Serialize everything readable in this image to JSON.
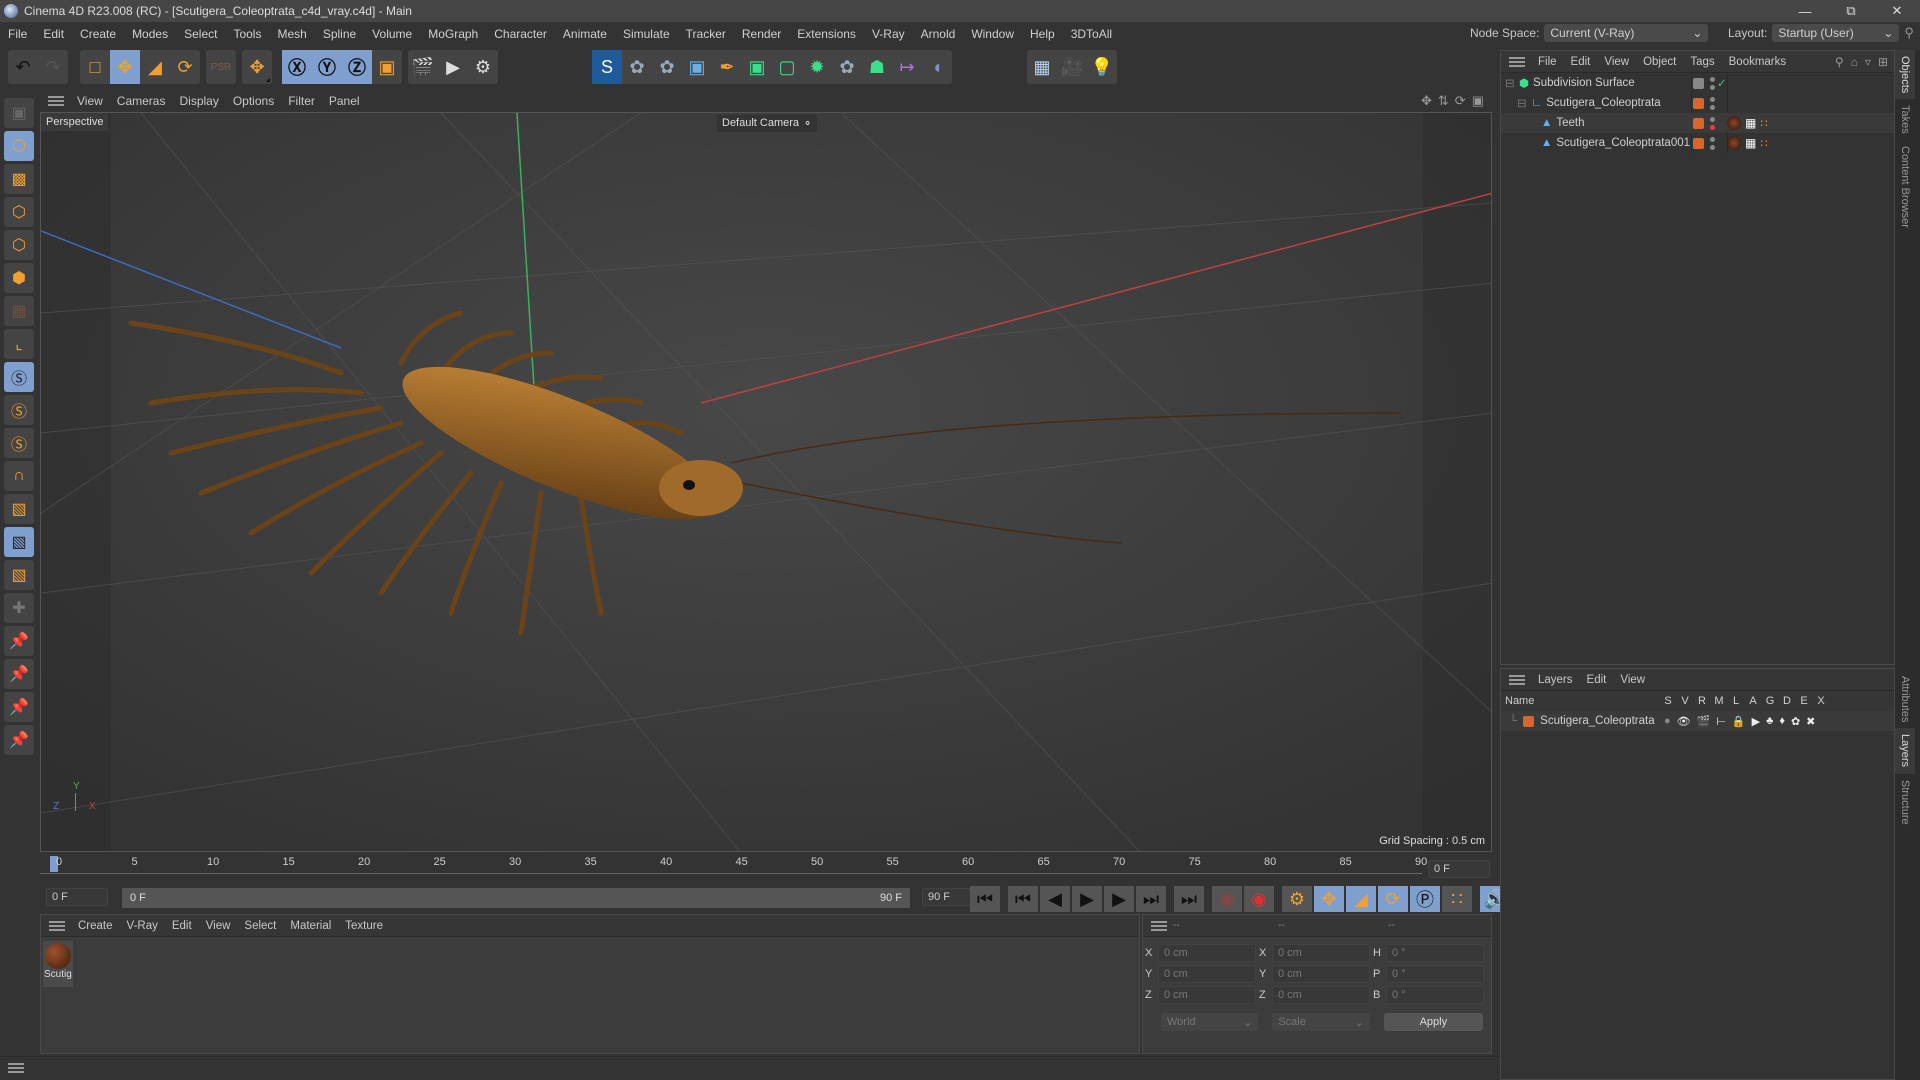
{
  "app": {
    "title": "Cinema 4D R23.008 (RC) - [Scutigera_Coleoptrata_c4d_vray.c4d] - Main",
    "window_controls": [
      "minimize",
      "restore",
      "close"
    ]
  },
  "menubar": [
    "File",
    "Edit",
    "Create",
    "Modes",
    "Select",
    "Tools",
    "Mesh",
    "Spline",
    "Volume",
    "MoGraph",
    "Character",
    "Animate",
    "Simulate",
    "Tracker",
    "Render",
    "Extensions",
    "V-Ray",
    "Arnold",
    "Window",
    "Help",
    "3DToAll"
  ],
  "node_space": {
    "label": "Node Space:",
    "value": "Current (V-Ray)"
  },
  "layout": {
    "label": "Layout:",
    "value": "Startup (User)"
  },
  "toolbar": {
    "groups": [
      [
        "undo-icon",
        "redo-icon"
      ],
      [
        "live-selection-icon",
        "move-icon",
        "scale-icon",
        "rotate-icon"
      ],
      [
        "psr-icon"
      ],
      [
        "transform-icon"
      ],
      [
        "x-axis-icon",
        "y-axis-icon",
        "z-axis-icon",
        "coordinate-system-icon"
      ],
      [
        "render-view-icon",
        "render-picture-viewer-icon",
        "render-settings-icon"
      ],
      [
        "vray-icon",
        "python-icon",
        "python-icon",
        "cube-icon",
        "pen-icon",
        "subdivision-icon",
        "extrude-icon",
        "mesh-icon",
        "python-icon",
        "cloner-icon",
        "bend-icon",
        "deformer-icon"
      ],
      [
        "floor-icon",
        "camera-icon",
        "light-icon"
      ]
    ],
    "active": [
      "move-icon",
      "x-axis-icon",
      "y-axis-icon",
      "z-axis-icon",
      "vray-icon"
    ]
  },
  "left_tools": [
    "make-editable-icon",
    "model-mode-icon",
    "texture-mode-icon",
    "point-mode-icon",
    "edge-mode-icon",
    "polygon-mode-icon",
    "uv-mode-icon",
    "axis-icon",
    "snap-icon",
    "snap-settings-icon",
    "snap-special-icon",
    "magnet-icon",
    "workplane-icon",
    "workplane-lock-icon",
    "workplane-align-icon",
    "add-joint-icon",
    "pin-icon",
    "pin-p-icon",
    "pin-r-icon",
    "pin-scale-icon"
  ],
  "viewport": {
    "menu": [
      "View",
      "Cameras",
      "Display",
      "Options",
      "Filter",
      "Panel"
    ],
    "label": "Perspective",
    "camera": "Default Camera",
    "grid_spacing": "Grid Spacing : 0.5 cm",
    "axis_labels": {
      "x": "X",
      "y": "Y",
      "z": "Z"
    },
    "nav_icons": [
      "move-view-icon",
      "dolly-view-icon",
      "rotate-view-icon",
      "toggle-view-icon"
    ]
  },
  "timeline": {
    "ticks": [
      "0",
      "5",
      "10",
      "15",
      "20",
      "25",
      "30",
      "35",
      "40",
      "45",
      "50",
      "55",
      "60",
      "65",
      "70",
      "75",
      "80",
      "85",
      "90"
    ],
    "current_frame_right": "0 F",
    "start_frame": "0 F",
    "range_start": "0 F",
    "range_end": "90 F",
    "end_frame": "90 F",
    "playhead": 0
  },
  "transport": [
    "go-to-start-icon",
    "prev-key-icon",
    "prev-frame-icon",
    "play-icon",
    "next-frame-icon",
    "next-key-icon",
    "go-to-end-icon",
    "record-keys-icon",
    "autokey-icon",
    "keyframe-selection-icon",
    "key-position-icon",
    "key-scale-icon",
    "key-rotation-icon",
    "key-parameter-icon",
    "key-pla-icon",
    "sound-icon",
    "film-icon"
  ],
  "material_manager": {
    "menu": [
      "Create",
      "V-Ray",
      "Edit",
      "View",
      "Select",
      "Material",
      "Texture"
    ],
    "materials": [
      {
        "name": "Scutig"
      }
    ]
  },
  "coord_manager": {
    "headers": [
      "--",
      "--",
      "--"
    ],
    "rows": [
      {
        "l1": "X",
        "v1": "0 cm",
        "l2": "X",
        "v2": "0 cm",
        "l3": "H",
        "v3": "0 °"
      },
      {
        "l1": "Y",
        "v1": "0 cm",
        "l2": "Y",
        "v2": "0 cm",
        "l3": "P",
        "v3": "0 °"
      },
      {
        "l1": "Z",
        "v1": "0 cm",
        "l2": "Z",
        "v2": "0 cm",
        "l3": "B",
        "v3": "0 °"
      }
    ],
    "space": "World",
    "mode": "Scale",
    "apply": "Apply"
  },
  "object_manager": {
    "menu": [
      "File",
      "Edit",
      "View",
      "Object",
      "Tags",
      "Bookmarks"
    ],
    "objects": [
      {
        "name": "Subdivision Surface",
        "depth": 0,
        "icon": "subdivision-icon"
      },
      {
        "name": "Scutigera_Coleoptrata",
        "depth": 1,
        "icon": "null-icon"
      },
      {
        "name": "Teeth",
        "depth": 2,
        "icon": "polygon-object-icon"
      },
      {
        "name": "Scutigera_Coleoptrata001",
        "depth": 2,
        "icon": "polygon-object-icon"
      }
    ]
  },
  "layer_manager": {
    "menu": [
      "Layers",
      "Edit",
      "View"
    ],
    "columns": [
      "Name",
      "S",
      "V",
      "R",
      "M",
      "L",
      "A",
      "G",
      "D",
      "E",
      "X"
    ],
    "layers": [
      {
        "name": "Scutigera_Coleoptrata",
        "color": "#d9662a"
      }
    ]
  },
  "side_tabs": {
    "top": [
      "Objects",
      "Takes",
      "Content Browser"
    ],
    "bottom": [
      "Attributes",
      "Layers",
      "Structure"
    ]
  },
  "colors": {
    "accent": "#7f9fcf",
    "orange": "#f0a030",
    "layer": "#d9662a"
  }
}
